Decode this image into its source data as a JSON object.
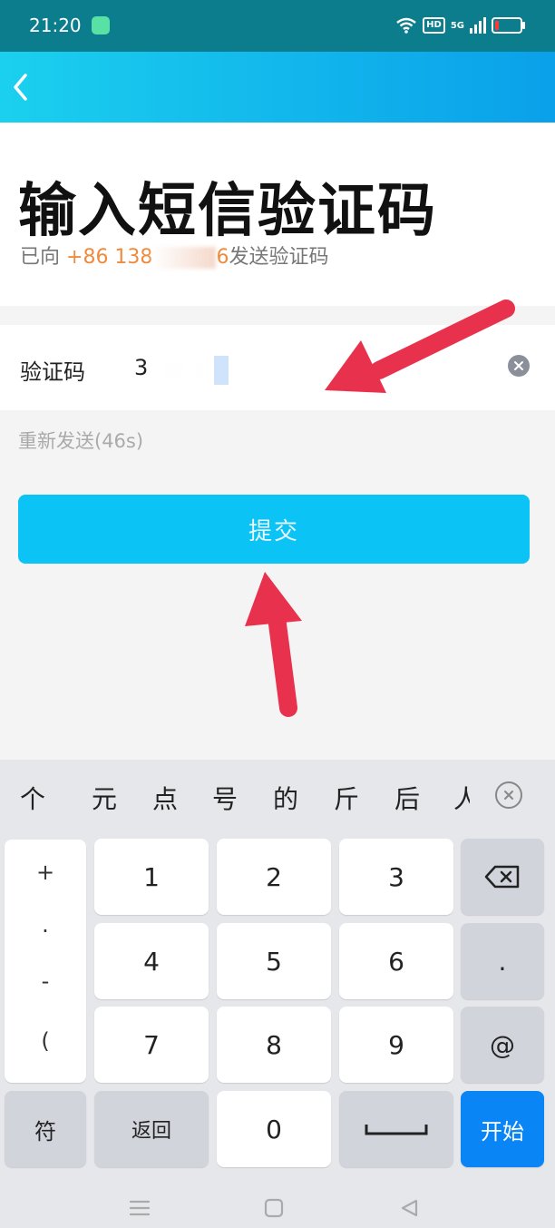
{
  "status_bar": {
    "time": "21:20",
    "hd": "HD",
    "network": "5G"
  },
  "page": {
    "title": "输入短信验证码",
    "subtitle_prefix": "已向",
    "phone_visible": "+86 138",
    "phone_suffix": "6",
    "subtitle_suffix": "发送验证码"
  },
  "form": {
    "code_label": "验证码",
    "code_value": "3",
    "resend_label": "重新发送(46s)",
    "submit_label": "提交"
  },
  "keyboard": {
    "suggestions": [
      "个",
      "元",
      "点",
      "号",
      "的",
      "斤",
      "后",
      "人"
    ],
    "symbols": [
      "+",
      ".",
      "-",
      "("
    ],
    "digits": [
      "1",
      "2",
      "3",
      "4",
      "5",
      "6",
      "7",
      "8",
      "9",
      "0"
    ],
    "dot": ".",
    "at": "@",
    "symbol_key": "符",
    "back_key": "返回",
    "start_key": "开始"
  },
  "colors": {
    "header_start": "#1bd0ee",
    "header_end": "#0aa0ea",
    "submit": "#0bc3f5",
    "phone_highlight": "#ee8b3e",
    "arrow": "#e8324d",
    "start_key": "#0a85f5"
  }
}
